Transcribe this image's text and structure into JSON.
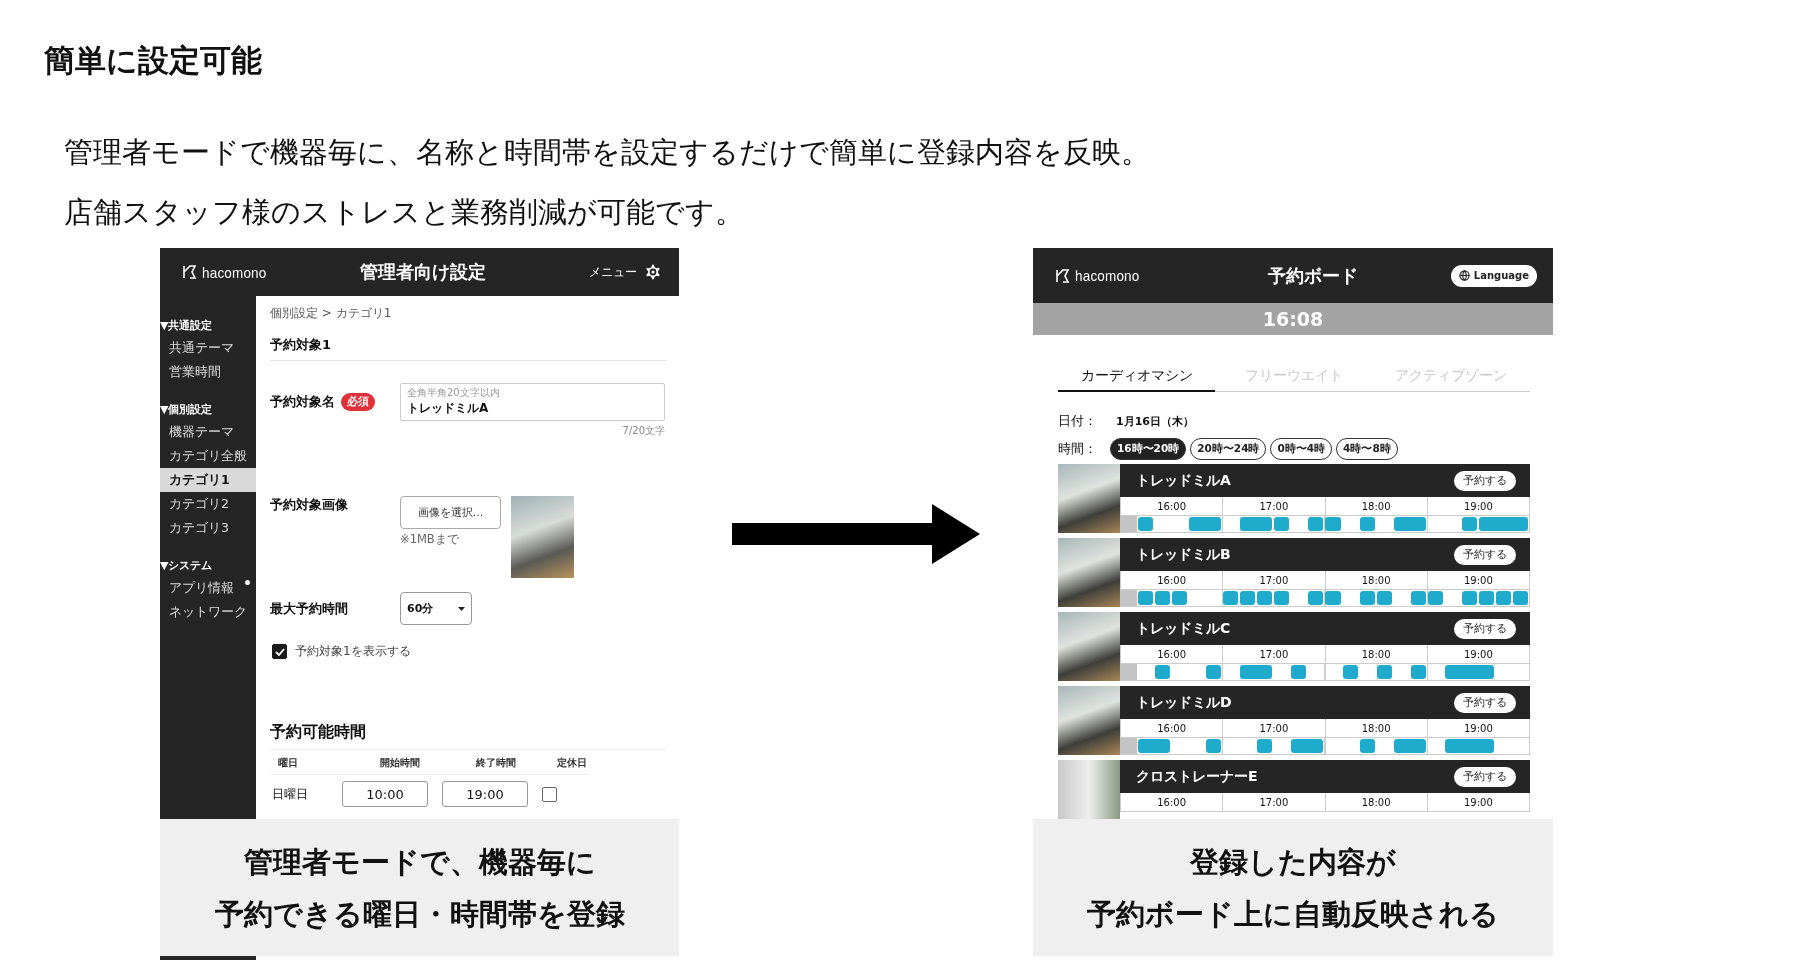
{
  "heading": "簡単に設定可能",
  "description": [
    "管理者モードで機器毎に、名称と時間帯を設定するだけで簡単に登録内容を反映。",
    "店舗スタッフ様のストレスと業務削減が可能です。"
  ],
  "admin_screen": {
    "logo": "hacomono",
    "title": "管理者向け設定",
    "menu": "メニュー",
    "sidebar": [
      {
        "label": "▼共通設定",
        "children": [
          {
            "label": "共通テーマ",
            "selected": false,
            "notice": false
          },
          {
            "label": "営業時間",
            "selected": false,
            "notice": false
          }
        ]
      },
      {
        "label": "▼個別設定",
        "children": [
          {
            "label": "機器テーマ",
            "selected": false,
            "notice": false
          },
          {
            "label": "カテゴリ全般",
            "selected": false,
            "notice": false
          },
          {
            "label": "カテゴリ1",
            "selected": true,
            "notice": false
          },
          {
            "label": "カテゴリ2",
            "selected": false,
            "notice": false
          },
          {
            "label": "カテゴリ3",
            "selected": false,
            "notice": false
          }
        ]
      },
      {
        "label": "▼システム",
        "children": [
          {
            "label": "アプリ情報",
            "selected": false,
            "notice": true
          },
          {
            "label": "ネットワーク",
            "selected": false,
            "notice": false
          }
        ]
      }
    ],
    "breadcrumb": "個別設定 > カテゴリ1",
    "section_title": "予約対象1",
    "name_field": {
      "label": "予約対象名",
      "required_badge": "必須",
      "floating_label": "全角半角20文字以内",
      "value": "トレッドミルA",
      "counter": "7/20文字"
    },
    "image_field": {
      "label": "予約対象画像",
      "button": "画像を選択...",
      "note": "※1MBまで"
    },
    "max_time": {
      "label": "最大予約時間",
      "value": "60分"
    },
    "show_checkbox": {
      "label": "予約対象1を表示する",
      "checked": true
    },
    "schedule": {
      "title": "予約可能時間",
      "columns": [
        "曜日",
        "開始時間",
        "終了時間",
        "定休日"
      ],
      "rows": [
        {
          "day": "日曜日",
          "start": "10:00",
          "end": "19:00",
          "closed": false
        }
      ]
    }
  },
  "admin_caption": [
    "管理者モードで、機器毎に",
    "予約できる曜日・時間帯を登録"
  ],
  "board_screen": {
    "logo": "hacomono",
    "title": "予約ボード",
    "language_button": "Language",
    "clock": "16:08",
    "tabs": [
      {
        "label": "カーディオマシン",
        "selected": true
      },
      {
        "label": "フリーウエイト",
        "selected": false
      },
      {
        "label": "アクティブゾーン",
        "selected": false
      }
    ],
    "date_label": "日付：",
    "date": "1月16日（木）",
    "time_label": "時間：",
    "time_ranges": [
      {
        "label": "16時〜20時",
        "selected": true
      },
      {
        "label": "20時〜24時",
        "selected": false
      },
      {
        "label": "0時〜4時",
        "selected": false
      },
      {
        "label": "4時〜8時",
        "selected": false
      }
    ],
    "machines": [
      {
        "name": "トレッドミルA",
        "button": "予約する",
        "hours": [
          "16:00",
          "17:00",
          "18:00",
          "19:00"
        ],
        "slots": [
          {
            "kind": "past"
          },
          {
            "kind": "start"
          },
          {
            "kind": "free"
          },
          {
            "kind": "free"
          },
          {
            "kind": "start"
          },
          {
            "kind": "more"
          },
          {
            "kind": "free"
          },
          {
            "kind": "start"
          },
          {
            "kind": "more"
          },
          {
            "kind": "start"
          },
          {
            "kind": "free"
          },
          {
            "kind": "start"
          },
          {
            "kind": "start"
          },
          {
            "kind": "free"
          },
          {
            "kind": "start"
          },
          {
            "kind": "free"
          },
          {
            "kind": "start"
          },
          {
            "kind": "more"
          },
          {
            "kind": "free"
          },
          {
            "kind": "free"
          },
          {
            "kind": "start"
          },
          {
            "kind": "start"
          },
          {
            "kind": "more"
          },
          {
            "kind": "more"
          }
        ]
      },
      {
        "name": "トレッドミルB",
        "button": "予約する",
        "hours": [
          "16:00",
          "17:00",
          "18:00",
          "19:00"
        ],
        "slots": [
          {
            "kind": "past"
          },
          {
            "kind": "start"
          },
          {
            "kind": "start"
          },
          {
            "kind": "start"
          },
          {
            "kind": "free"
          },
          {
            "kind": "free"
          },
          {
            "kind": "start"
          },
          {
            "kind": "start"
          },
          {
            "kind": "start"
          },
          {
            "kind": "start"
          },
          {
            "kind": "free"
          },
          {
            "kind": "start"
          },
          {
            "kind": "start"
          },
          {
            "kind": "free"
          },
          {
            "kind": "start"
          },
          {
            "kind": "start"
          },
          {
            "kind": "free"
          },
          {
            "kind": "start"
          },
          {
            "kind": "start"
          },
          {
            "kind": "free"
          },
          {
            "kind": "start"
          },
          {
            "kind": "start"
          },
          {
            "kind": "start"
          },
          {
            "kind": "start"
          }
        ]
      },
      {
        "name": "トレッドミルC",
        "button": "予約する",
        "hours": [
          "16:00",
          "17:00",
          "18:00",
          "19:00"
        ],
        "slots": [
          {
            "kind": "past"
          },
          {
            "kind": "free"
          },
          {
            "kind": "start"
          },
          {
            "kind": "free"
          },
          {
            "kind": "free"
          },
          {
            "kind": "start"
          },
          {
            "kind": "free"
          },
          {
            "kind": "start"
          },
          {
            "kind": "more"
          },
          {
            "kind": "free"
          },
          {
            "kind": "start"
          },
          {
            "kind": "free"
          },
          {
            "kind": "free"
          },
          {
            "kind": "start"
          },
          {
            "kind": "free"
          },
          {
            "kind": "start"
          },
          {
            "kind": "free"
          },
          {
            "kind": "start"
          },
          {
            "kind": "free"
          },
          {
            "kind": "start"
          },
          {
            "kind": "more"
          },
          {
            "kind": "more"
          },
          {
            "kind": "free"
          },
          {
            "kind": "free"
          }
        ]
      },
      {
        "name": "トレッドミルD",
        "button": "予約する",
        "hours": [
          "16:00",
          "17:00",
          "18:00",
          "19:00"
        ],
        "slots": [
          {
            "kind": "past"
          },
          {
            "kind": "start"
          },
          {
            "kind": "more"
          },
          {
            "kind": "free"
          },
          {
            "kind": "free"
          },
          {
            "kind": "start"
          },
          {
            "kind": "free"
          },
          {
            "kind": "free"
          },
          {
            "kind": "start"
          },
          {
            "kind": "free"
          },
          {
            "kind": "start"
          },
          {
            "kind": "more"
          },
          {
            "kind": "free"
          },
          {
            "kind": "free"
          },
          {
            "kind": "start"
          },
          {
            "kind": "free"
          },
          {
            "kind": "start"
          },
          {
            "kind": "more"
          },
          {
            "kind": "free"
          },
          {
            "kind": "start"
          },
          {
            "kind": "more"
          },
          {
            "kind": "more"
          },
          {
            "kind": "free"
          },
          {
            "kind": "free"
          }
        ]
      },
      {
        "name": "クロストレーナーE",
        "button": "予約する",
        "hours": [
          "16:00",
          "17:00",
          "18:00",
          "19:00"
        ]
      }
    ]
  },
  "board_caption": [
    "登録した内容が",
    "予約ボード上に自動反映される"
  ]
}
